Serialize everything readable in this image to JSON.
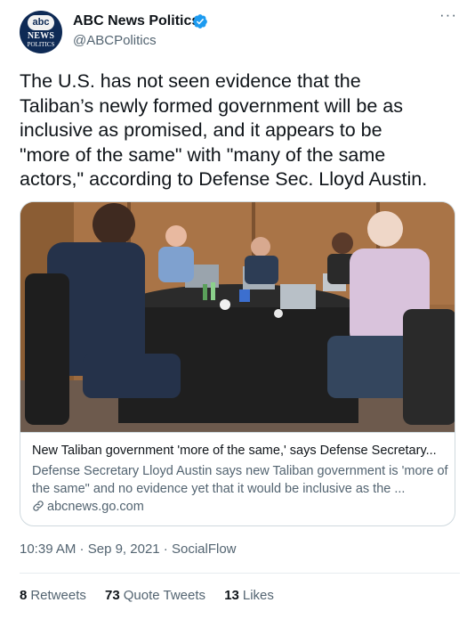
{
  "account": {
    "display_name": "ABC News Politics",
    "handle": "@ABCPolitics",
    "avatar_text": {
      "abc": "abc",
      "news": "NEWS",
      "politics": "POLITICS"
    },
    "verified_icon": "verified-badge-icon",
    "verified_color": "#1d9bf0"
  },
  "tweet": {
    "text": "The U.S. has not seen evidence that the\nTaliban’s newly formed government will be as\ninclusive as promised, and it appears to be\n\"more of the same\" with \"many of the same\nactors,\" according to Defense Sec. Lloyd Austin."
  },
  "card": {
    "image_icon": "meeting-photo",
    "title": "New Taliban government 'more of the same,' says Defense Secretary...",
    "description": "Defense Secretary Lloyd Austin says new Taliban government is 'more of the same\" and no evidence yet that it would be inclusive as the ...",
    "domain": "abcnews.go.com",
    "domain_icon": "link-icon"
  },
  "meta": {
    "time": "10:39 AM",
    "separator": " · ",
    "date": "Sep 9, 2021",
    "source": "SocialFlow"
  },
  "stats": {
    "retweets_count": "8",
    "retweets_label": "Retweets",
    "quotes_count": "73",
    "quotes_label": "Quote Tweets",
    "likes_count": "13",
    "likes_label": "Likes"
  },
  "menu_icon": "more-options-icon"
}
